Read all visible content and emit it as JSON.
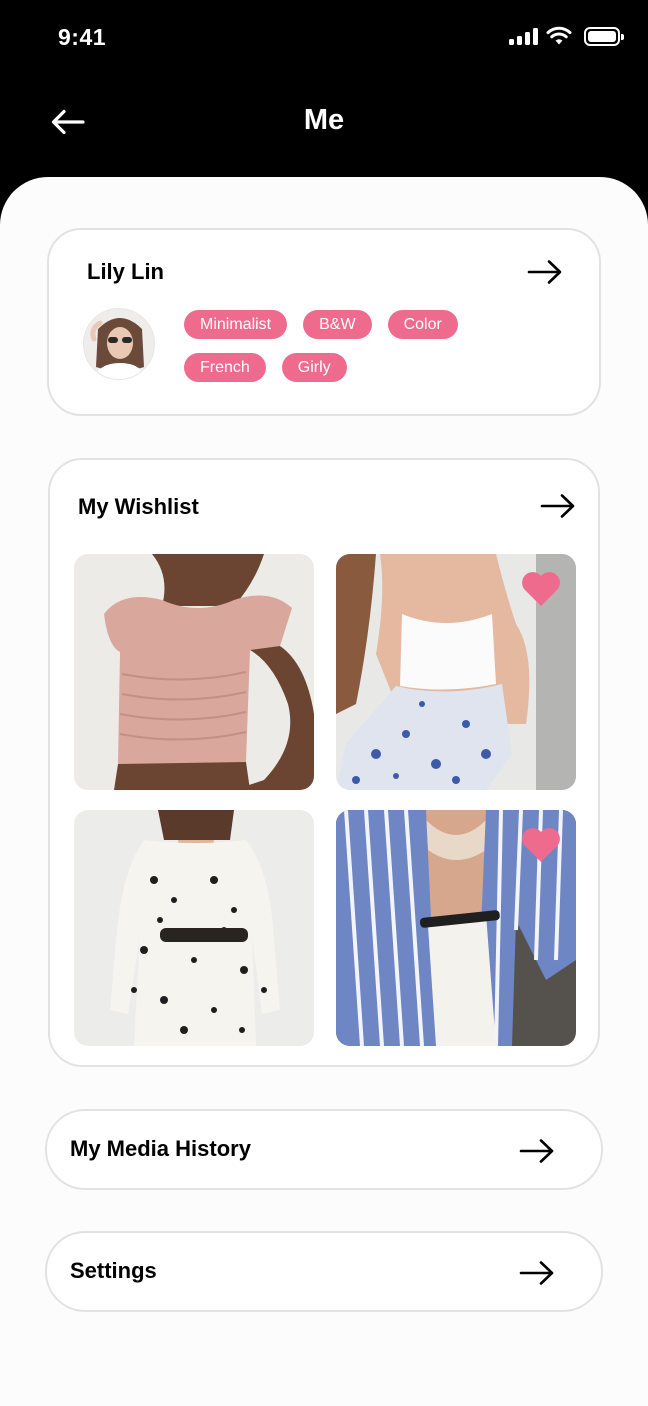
{
  "status_bar": {
    "time": "9:41"
  },
  "header": {
    "title": "Me"
  },
  "profile": {
    "name": "Lily Lin",
    "tags": [
      [
        "Minimalist",
        "B&W",
        "Color"
      ],
      [
        "French",
        "Girly"
      ]
    ]
  },
  "wishlist": {
    "title": "My Wishlist",
    "items": [
      {
        "image": "pink-ruched-polka-dot-top",
        "liked": false
      },
      {
        "image": "white-tank-floral-skirt",
        "liked": true
      },
      {
        "image": "black-white-floral-belted-dress",
        "liked": false
      },
      {
        "image": "blue-striped-shirt-white-pants",
        "liked": true
      }
    ]
  },
  "media_history": {
    "label": "My Media History"
  },
  "settings": {
    "label": "Settings"
  },
  "colors": {
    "accent": "#ee6b8e",
    "header_bg": "#000000",
    "sheet_bg": "#fcfcfc",
    "card_border": "#e2e2e2"
  },
  "icons": [
    "back-arrow-icon",
    "arrow-right-icon",
    "heart-icon",
    "signal-icon",
    "wifi-icon",
    "battery-icon"
  ]
}
